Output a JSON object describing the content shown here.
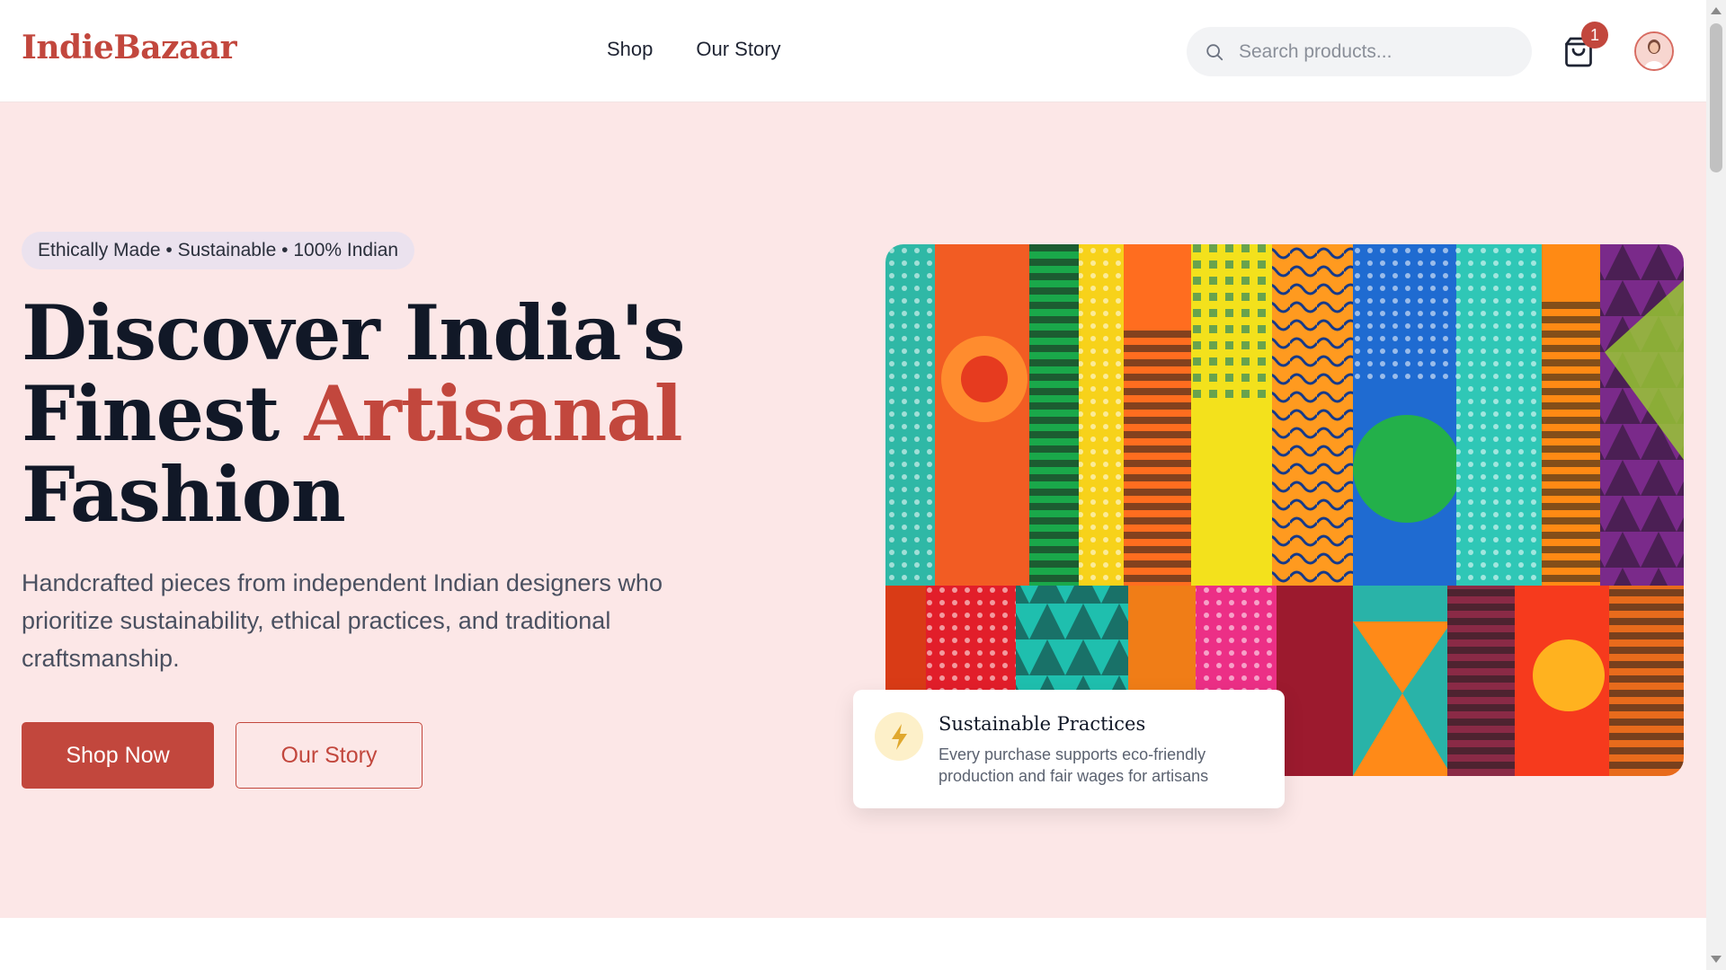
{
  "header": {
    "logo": "IndieBazaar",
    "nav": [
      {
        "label": "Shop"
      },
      {
        "label": "Our Story"
      }
    ],
    "search": {
      "placeholder": "Search products...",
      "value": ""
    },
    "cart": {
      "icon": "shopping-bag-icon",
      "count": "1"
    },
    "avatar": {
      "icon": "user-avatar"
    }
  },
  "hero": {
    "tagline": "Ethically Made • Sustainable • 100% Indian",
    "headline": {
      "line1": "Discover India's",
      "line2_plain": "Finest ",
      "line2_accent": "Artisanal",
      "line3": "Fashion"
    },
    "subtitle": "Handcrafted pieces from independent Indian designers who prioritize sustainability, ethical practices, and traditional craftsmanship.",
    "primary_button": "Shop Now",
    "secondary_button": "Our Story",
    "image": {
      "subject": "colorful-patterned-fabrics"
    },
    "feature_card": {
      "icon": "lightning-bolt-icon",
      "title": "Sustainable Practices",
      "description": "Every purchase supports eco-friendly production and fair wages for artisans"
    }
  },
  "colors": {
    "brand": "#c2473d",
    "hero_background": "#fce7e7",
    "tagline_background": "#ebe2ee",
    "heading": "#111827",
    "body_text": "#4a5060",
    "feature_icon_background": "#fdf0c9",
    "feature_icon_color": "#e0a82e"
  }
}
